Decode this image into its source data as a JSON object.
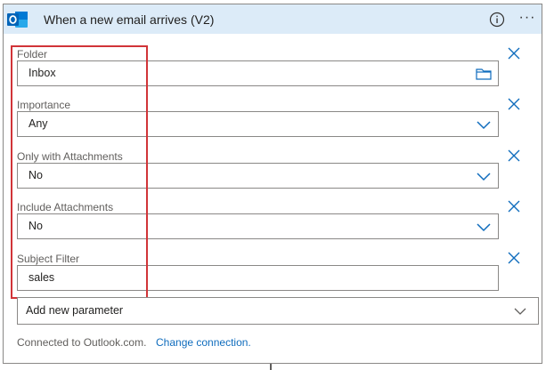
{
  "header": {
    "title": "When a new email arrives (V2)",
    "logo_icon": "outlook-icon",
    "info_icon": "info-icon",
    "more_label": "···",
    "background": "#dcebf8"
  },
  "fields": [
    {
      "label": "Folder",
      "value": "Inbox",
      "icon": "folder-icon"
    },
    {
      "label": "Importance",
      "value": "Any",
      "icon": "chevron-down-icon"
    },
    {
      "label": "Only with Attachments",
      "value": "No",
      "icon": "chevron-down-icon"
    },
    {
      "label": "Include Attachments",
      "value": "No",
      "icon": "chevron-down-icon"
    },
    {
      "label": "Subject Filter",
      "value": "sales",
      "icon": ""
    }
  ],
  "add_parameter": {
    "label": "Add new parameter",
    "icon": "chevron-down-icon"
  },
  "footer": {
    "connected_text": "Connected to Outlook.com.",
    "change_link": "Change connection."
  },
  "colors": {
    "accent": "#0f6cbd",
    "highlight": "#d13438",
    "outlook_blue": "#0364b8"
  }
}
